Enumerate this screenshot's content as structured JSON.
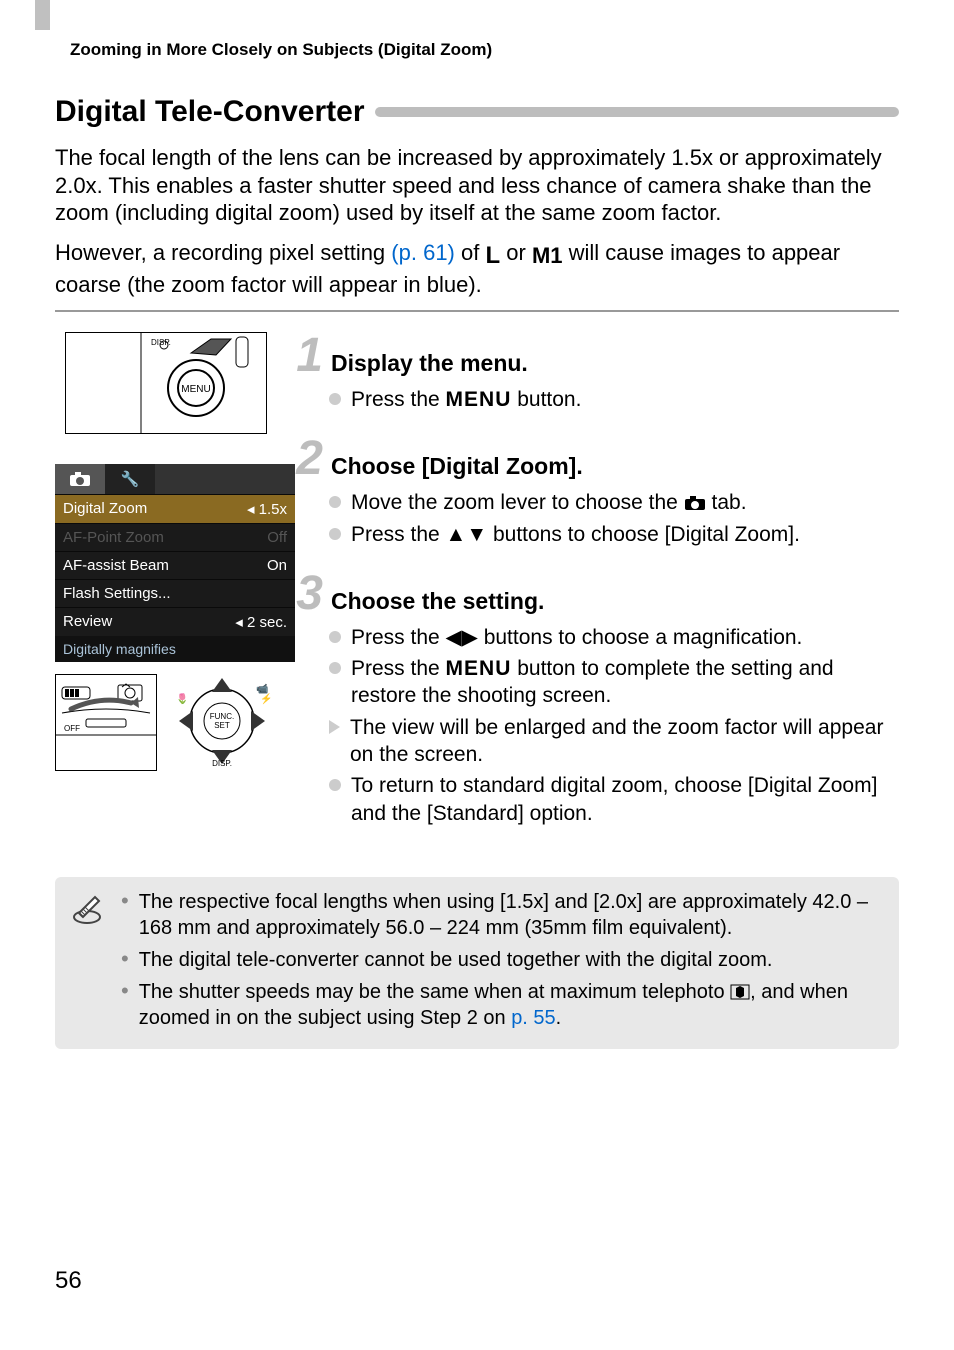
{
  "header": "Zooming in More Closely on Subjects (Digital Zoom)",
  "section_title": "Digital Tele-Converter",
  "intro": {
    "part1": "The focal length of the lens can be increased by approximately 1.5x or approximately 2.0x. This enables a faster shutter speed and less chance of camera shake than the zoom (including digital zoom) used by itself at the same zoom factor.",
    "part2a": "However, a recording pixel setting ",
    "pref": "(p. 61)",
    "part2b": " of ",
    "L_icon": "L",
    "or": " or ",
    "M1_icon": "M1",
    "part2c": " will cause images to appear coarse (the zoom factor will appear in blue)."
  },
  "menu_screenshot": {
    "rows": [
      {
        "label": "Digital Zoom",
        "value": "1.5x",
        "selected": true
      },
      {
        "label": "AF-Point Zoom",
        "value": "Off",
        "dimmed": true
      },
      {
        "label": "AF-assist Beam",
        "value": "On"
      },
      {
        "label": "Flash Settings...",
        "value": ""
      },
      {
        "label": "Review",
        "value": "2 sec."
      }
    ],
    "helper": "Digitally magnifies"
  },
  "steps": [
    {
      "num": "1",
      "title": "Display the menu.",
      "bullets": [
        {
          "type": "circle",
          "t1": "Press the ",
          "btn": "MENU",
          "t2": " button."
        }
      ]
    },
    {
      "num": "2",
      "title": "Choose [Digital Zoom].",
      "bullets": [
        {
          "type": "circle",
          "t1": "Move the zoom lever to choose the ",
          "icon": "camera",
          "t2": " tab."
        },
        {
          "type": "circle",
          "t1": "Press the ",
          "icon": "ud",
          "t2": " buttons to choose [Digital Zoom]."
        }
      ]
    },
    {
      "num": "3",
      "title": "Choose the setting.",
      "bullets": [
        {
          "type": "circle",
          "t1": "Press the ",
          "icon": "lr",
          "t2": " buttons to choose a magnification."
        },
        {
          "type": "circle",
          "t1": "Press the ",
          "btn": "MENU",
          "t2": " button to complete the setting and restore the shooting screen."
        },
        {
          "type": "tri",
          "t1": "The view will be enlarged and the zoom factor will appear on the screen."
        },
        {
          "type": "circle",
          "t1": "To return to standard digital zoom, choose [Digital Zoom] and the [Standard] option."
        }
      ]
    }
  ],
  "notes": [
    {
      "text": "The respective focal lengths when using [1.5x] and [2.0x] are approximately 42.0 – 168 mm and approximately 56.0 – 224 mm (35mm film equivalent)."
    },
    {
      "text": "The digital tele-converter cannot be used together with the digital zoom."
    },
    {
      "t1": "The shutter speeds may be the same when at maximum telephoto ",
      "icon": "tele",
      "t2": ", and when zoomed in on the subject using Step 2 on ",
      "pref": "p. 55",
      "t3": "."
    }
  ],
  "page_number": "56"
}
